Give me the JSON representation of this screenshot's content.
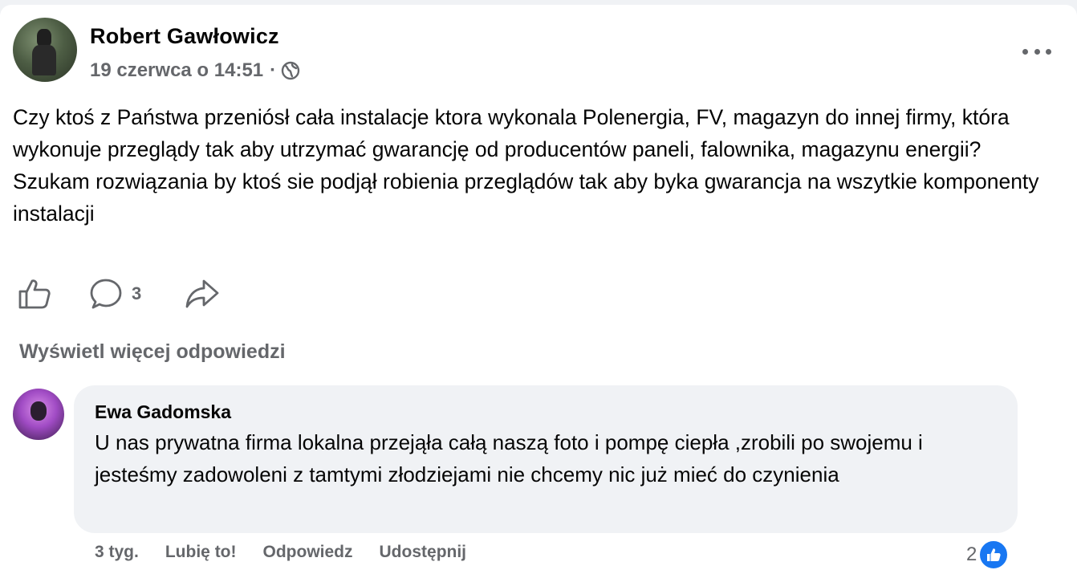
{
  "post": {
    "author": "Robert Gawłowicz",
    "timestamp": "19 czerwca o 14:51",
    "separator": "·",
    "audience_icon": "globe-icon",
    "text": "Czy ktoś z Państwa przeniósł cała instalacje ktora wykonala Polenergia,  FV, magazyn do innej firmy, która wykonuje przeglądy tak aby utrzymać gwarancję od producentów paneli,  falownika, magazynu energii?\nSzukam rozwiązania by ktoś sie podjął robienia przeglądów tak aby byka gwarancja na wszytkie komponenty instalacji",
    "comment_count": "3"
  },
  "view_more_replies": "Wyświetl więcej odpowiedzi",
  "comment": {
    "author": "Ewa Gadomska",
    "text": "U nas prywatna firma lokalna przejąła całą naszą foto i pompę ciepła ,zrobili po swojemu i jesteśmy zadowoleni z tamtymi złodziejami nie chcemy nic już mieć do czynienia",
    "age": "3 tyg.",
    "like_label": "Lubię to!",
    "reply_label": "Odpowiedz",
    "share_label": "Udostępnij",
    "reaction_count": "2"
  },
  "colors": {
    "text": "#050505",
    "secondary": "#65676b",
    "like_blue": "#1877f2",
    "bubble": "#f0f2f5"
  }
}
